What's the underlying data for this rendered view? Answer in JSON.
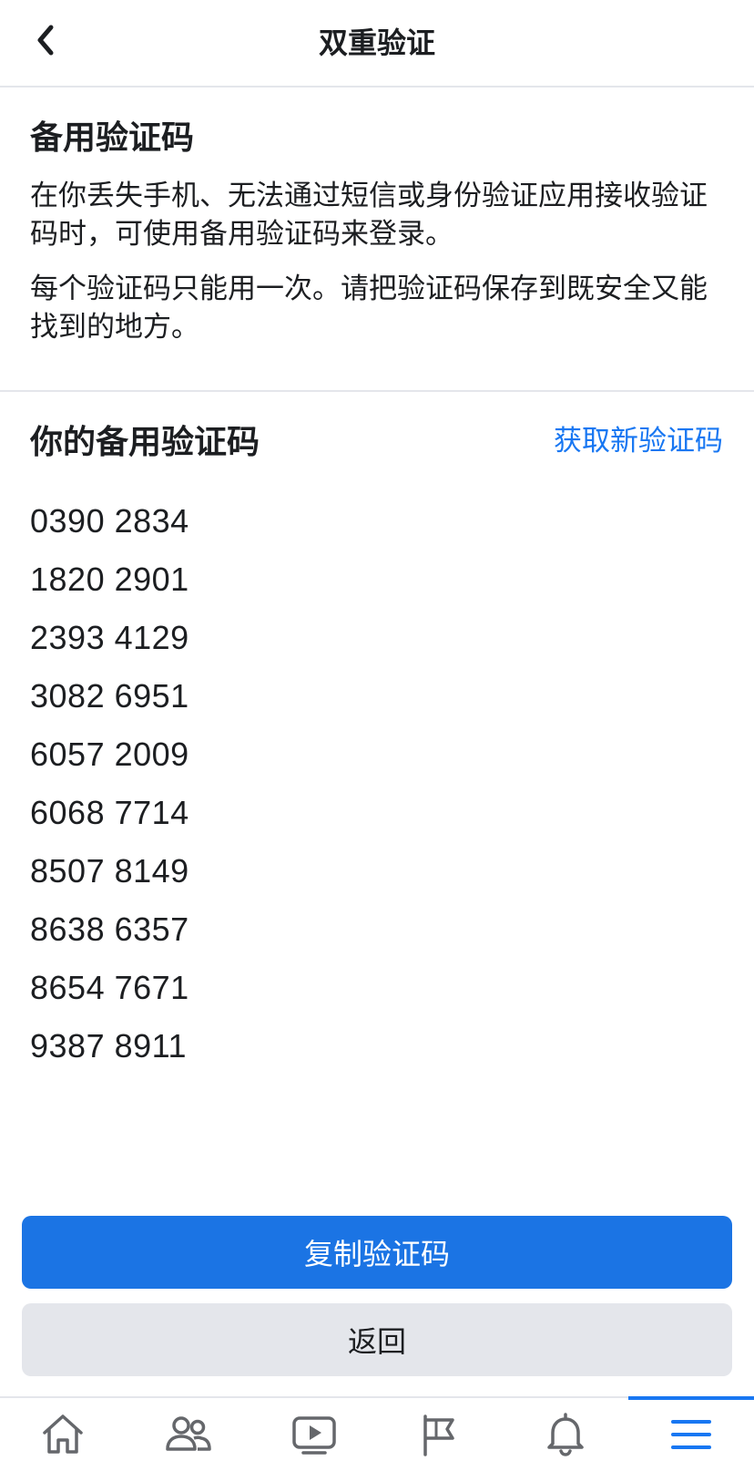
{
  "header": {
    "title": "双重验证",
    "back_icon": "chevron-left-icon"
  },
  "info": {
    "title": "备用验证码",
    "paragraph_1": "在你丢失手机、无法通过短信或身份验证应用接收验证码时，可使用备用验证码来登录。",
    "paragraph_2": "每个验证码只能用一次。请把验证码保存到既安全又能找到的地方。"
  },
  "codes": {
    "title": "你的备用验证码",
    "get_new_label": "获取新验证码",
    "items": [
      "0390 2834",
      "1820 2901",
      "2393 4129",
      "3082 6951",
      "6057 2009",
      "6068 7714",
      "8507 8149",
      "8638 6357",
      "8654 7671",
      "9387 8911"
    ]
  },
  "actions": {
    "copy_label": "复制验证码",
    "back_label": "返回"
  },
  "tabbar": {
    "items": [
      {
        "icon": "home-icon"
      },
      {
        "icon": "friends-icon"
      },
      {
        "icon": "watch-video-icon"
      },
      {
        "icon": "pages-flag-icon"
      },
      {
        "icon": "notifications-bell-icon"
      },
      {
        "icon": "menu-icon",
        "active": true
      }
    ]
  },
  "colors": {
    "accent": "#1877f2",
    "primary_button": "#1b74e4",
    "secondary_button": "#e4e6eb",
    "text": "#1c1e21",
    "divider": "#e4e6eb",
    "icon": "#65676b"
  }
}
